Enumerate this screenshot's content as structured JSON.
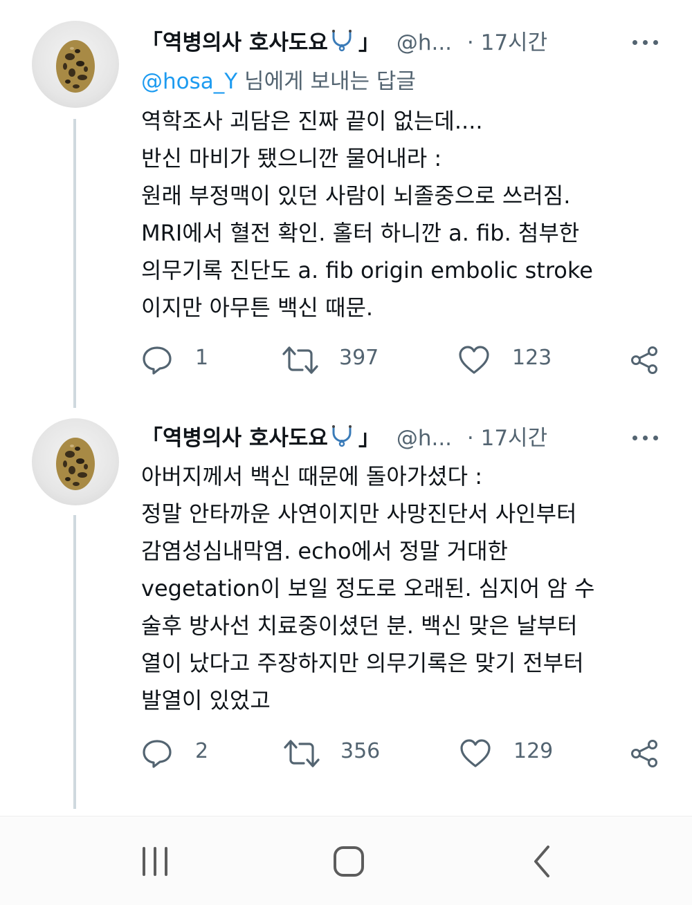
{
  "tweets": [
    {
      "author_name": "「역병의사 호사도요",
      "author_name_end": "」",
      "handle": "@h...",
      "time": "· 17시간",
      "reply_to": {
        "mention": "@hosa_Y",
        "text": " 님에게 보내는 답글"
      },
      "lines": [
        "역학조사 괴담은 진짜 끝이 없는데....",
        "반신 마비가 됐으니깐 물어내라 :",
        "원래 부정맥이 있던 사람이 뇌졸중으로 쓰러짐.",
        "MRI에서 혈전 확인. 홀터 하니깐 a. fib. 첨부한",
        "의무기록 진단도 a. fib origin embolic stroke",
        "이지만 아무튼 백신 때문."
      ],
      "replies": "1",
      "retweets": "397",
      "likes": "123"
    },
    {
      "author_name": "「역병의사 호사도요",
      "author_name_end": "」",
      "handle": "@h...",
      "time": "· 17시간",
      "lines": [
        "아버지께서 백신 때문에 돌아가셨다 :",
        "정말 안타까운 사연이지만 사망진단서 사인부터",
        "감염성심내막염. echo에서 정말 거대한",
        "vegetation이 보일 정도로 오래된. 심지어 암 수",
        "술후 방사선 치료중이셨던 분.  백신 맞은 날부터",
        "열이 났다고 주장하지만 의무기록은 맞기 전부터",
        "발열이 있었고"
      ],
      "replies": "2",
      "retweets": "356",
      "likes": "129"
    }
  ],
  "icons": {
    "stethoscope": "stethoscope-icon",
    "more": "more-options-icon",
    "reply": "reply-icon",
    "retweet": "retweet-icon",
    "like": "like-icon",
    "share": "share-icon",
    "nav_recents": "recent-apps-icon",
    "nav_home": "home-icon",
    "nav_back": "back-icon"
  },
  "colors": {
    "text": "#0f1419",
    "secondary": "#536471",
    "mention": "#1d9bf0",
    "thread_line": "#cfd9de"
  }
}
